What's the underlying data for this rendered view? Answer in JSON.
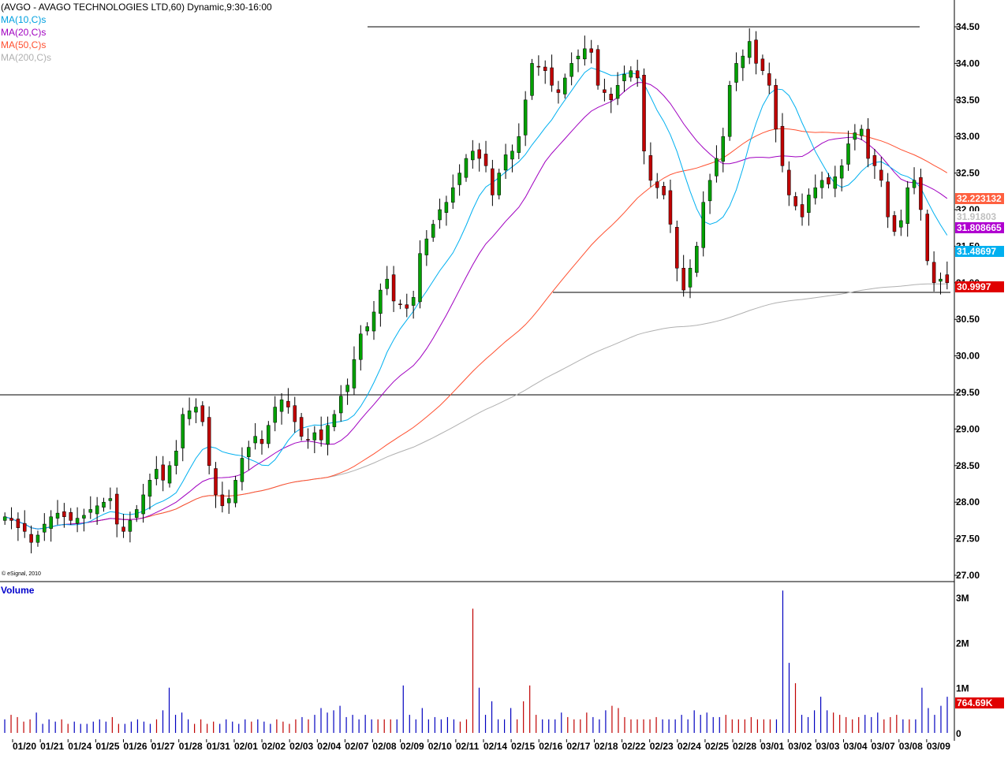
{
  "header": {
    "title": "(AVGO - AVAGO TECHNOLOGIES LTD,60) Dynamic,9:30-16:00",
    "ma10": "MA(10,C)s",
    "ma20": "MA(20,C)s",
    "ma50": "MA(50,C)s",
    "ma200": "MA(200,C)s"
  },
  "copyright": "© eSignal, 2010",
  "volume_label": "Volume",
  "colors": {
    "ma10": "#00b0f0",
    "ma20": "#a000c0",
    "ma50": "#ff5030",
    "ma200": "#b0b0b0",
    "up": "#00a000",
    "down": "#c00000",
    "vol_up": "#0000c0",
    "vol_down": "#c00000",
    "last": "#e00000"
  },
  "value_tags": {
    "ma50": "32.223132",
    "ma200": "31.91803",
    "ma20": "31.808665",
    "ma10": "31.48697",
    "last": "30.9997",
    "volume": "764.69K"
  },
  "chart_data": [
    {
      "type": "candlestick",
      "title": "(AVGO - AVAGO TECHNOLOGIES LTD,60) Dynamic,9:30-16:00",
      "ylim": [
        27.0,
        34.8
      ],
      "y_ticks": [
        "34.50",
        "34.00",
        "33.50",
        "33.00",
        "32.50",
        "32.00",
        "31.50",
        "31.00",
        "30.50",
        "30.00",
        "29.50",
        "29.00",
        "28.50",
        "28.00",
        "27.50",
        "27.00"
      ],
      "x_labels": [
        "01/20",
        "01/21",
        "01/24",
        "01/25",
        "01/26",
        "01/27",
        "01/28",
        "01/31",
        "02/01",
        "02/02",
        "02/03",
        "02/04",
        "02/07",
        "02/08",
        "02/09",
        "02/10",
        "02/11",
        "02/14",
        "02/15",
        "02/16",
        "02/17",
        "02/18",
        "02/22",
        "02/23",
        "02/24",
        "02/25",
        "02/28",
        "03/01",
        "03/02",
        "03/03",
        "03/04",
        "03/07",
        "03/08",
        "03/09"
      ],
      "close_series": [
        27.8,
        27.75,
        27.65,
        27.6,
        27.45,
        27.55,
        27.7,
        27.8,
        27.85,
        27.8,
        27.75,
        27.78,
        27.82,
        27.9,
        27.95,
        28.0,
        28.05,
        27.7,
        27.6,
        27.75,
        27.9,
        28.1,
        28.3,
        28.45,
        28.3,
        28.5,
        28.7,
        29.2,
        29.25,
        29.3,
        29.1,
        28.5,
        28.1,
        27.95,
        28.05,
        28.3,
        28.6,
        28.75,
        28.9,
        28.8,
        29.05,
        29.3,
        29.4,
        29.3,
        29.1,
        28.9,
        28.85,
        28.95,
        28.85,
        29.05,
        29.2,
        29.45,
        29.6,
        29.95,
        30.3,
        30.4,
        30.6,
        30.9,
        31.05,
        30.75,
        30.7,
        30.65,
        30.8,
        31.4,
        31.6,
        31.8,
        32.0,
        32.1,
        32.3,
        32.5,
        32.7,
        32.8,
        32.7,
        32.6,
        32.2,
        32.5,
        32.75,
        32.8,
        33.0,
        33.5,
        34.0,
        33.95,
        33.9,
        33.7,
        33.6,
        33.8,
        34.0,
        34.1,
        34.2,
        34.15,
        33.7,
        33.6,
        33.5,
        33.7,
        33.85,
        33.9,
        33.8,
        32.8,
        32.4,
        32.3,
        32.2,
        31.8,
        31.2,
        30.9,
        31.2,
        31.5,
        32.1,
        32.4,
        32.7,
        33.0,
        33.7,
        34.0,
        34.1,
        34.3,
        34.0,
        33.9,
        33.7,
        33.1,
        32.6,
        32.2,
        32.05,
        31.9,
        32.2,
        32.3,
        32.4,
        32.35,
        32.45,
        32.6,
        32.9,
        33.05,
        33.1,
        32.7,
        32.6,
        32.4,
        31.9,
        31.7,
        31.85,
        32.3,
        32.4,
        32.0,
        31.3,
        31.0,
        31.05,
        31.0
      ]
    },
    {
      "type": "bar",
      "title": "Volume",
      "y_ticks": [
        "3M",
        "2M",
        "1M",
        "0"
      ],
      "ylim": [
        0,
        3.0
      ],
      "values_millions": [
        0.3,
        0.4,
        0.35,
        0.25,
        0.3,
        0.45,
        0.2,
        0.3,
        0.25,
        0.3,
        0.2,
        0.25,
        0.2,
        0.2,
        0.25,
        0.3,
        0.25,
        0.35,
        0.2,
        0.2,
        0.25,
        0.3,
        0.25,
        0.2,
        0.3,
        0.5,
        1.0,
        0.4,
        0.45,
        0.3,
        0.2,
        0.3,
        0.2,
        0.25,
        0.2,
        0.3,
        0.25,
        0.2,
        0.3,
        0.25,
        0.3,
        0.25,
        0.2,
        0.3,
        0.25,
        0.2,
        0.3,
        0.35,
        0.3,
        0.4,
        0.55,
        0.45,
        0.5,
        0.6,
        0.35,
        0.4,
        0.3,
        0.4,
        0.3,
        0.3,
        0.3,
        0.3,
        0.3,
        1.05,
        0.4,
        0.3,
        0.55,
        0.3,
        0.35,
        0.3,
        0.35,
        0.3,
        0.25,
        0.3,
        2.75,
        1.0,
        0.4,
        0.7,
        0.3,
        0.3,
        0.55,
        0.3,
        0.7,
        1.05,
        0.4,
        0.3,
        0.3,
        0.3,
        0.45,
        0.35,
        0.3,
        0.3,
        0.45,
        0.35,
        0.3,
        0.5,
        0.6,
        0.55,
        0.35,
        0.3,
        0.3,
        0.3,
        0.3,
        0.35,
        0.3,
        0.3,
        0.3,
        0.4,
        0.3,
        0.5,
        0.4,
        0.45,
        0.35,
        0.35,
        0.4,
        0.3,
        0.3,
        0.3,
        0.35,
        0.3,
        0.3,
        0.3,
        0.3,
        3.15,
        1.55,
        1.1,
        0.4,
        0.35,
        0.5,
        0.8,
        0.5,
        0.45,
        0.4,
        0.35,
        0.3,
        0.35,
        0.4,
        0.35,
        0.45,
        0.3,
        0.35,
        0.4,
        0.3,
        0.3,
        0.3,
        1.0,
        0.55,
        0.4,
        0.6,
        0.8
      ]
    }
  ]
}
